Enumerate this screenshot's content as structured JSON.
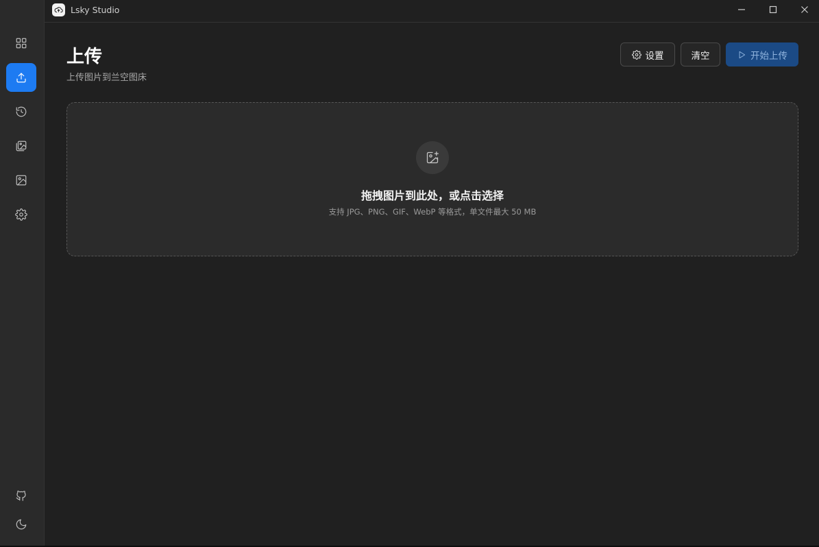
{
  "window": {
    "title": "Lsky Studio",
    "controls": [
      "minimize-icon",
      "maximize-icon",
      "close-icon"
    ]
  },
  "sidebar": {
    "items": [
      {
        "name": "dashboard",
        "icon": "grid-icon",
        "active": false
      },
      {
        "name": "upload",
        "icon": "upload-icon",
        "active": true
      },
      {
        "name": "history",
        "icon": "history-icon",
        "active": false
      },
      {
        "name": "gallery",
        "icon": "gallery-icon",
        "active": false
      },
      {
        "name": "images",
        "icon": "image-icon",
        "active": false
      },
      {
        "name": "settings",
        "icon": "gear-icon",
        "active": false
      }
    ],
    "bottom": [
      {
        "name": "github",
        "icon": "github-icon"
      },
      {
        "name": "theme",
        "icon": "moon-icon"
      }
    ]
  },
  "header": {
    "title": "上传",
    "subtitle": "上传图片到兰空图床",
    "settings_label": "设置",
    "clear_label": "清空",
    "start_label": "开始上传"
  },
  "dropzone": {
    "icon": "image-plus-icon",
    "title": "拖拽图片到此处，或点击选择",
    "hint": "支持 JPG、PNG、GIF、WebP 等格式，单文件最大 50 MB"
  },
  "colors": {
    "accent": "#1d7bf2",
    "background": "#202020",
    "sidebar": "#2a2a2a",
    "primary_button": "#1b4a85"
  }
}
